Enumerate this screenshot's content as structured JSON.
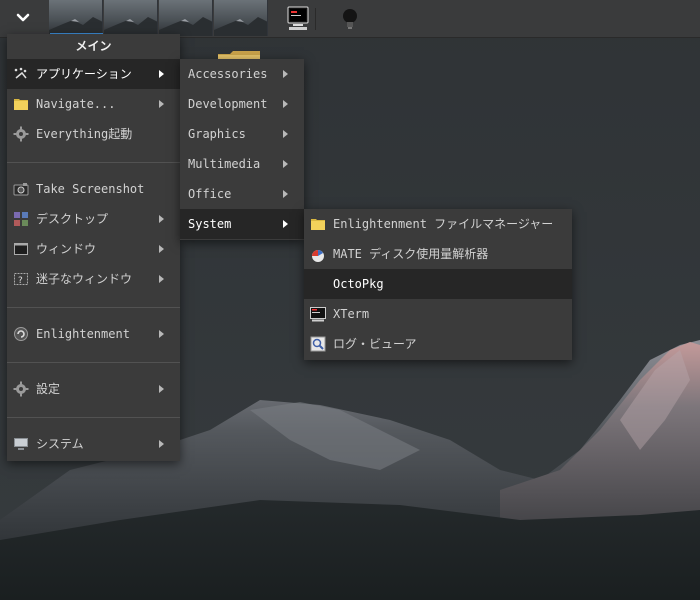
{
  "shelf": {
    "start_icon": "chevron-down-icon",
    "pager": {
      "desk_count": 4,
      "active_index": 0
    },
    "tray": [
      {
        "name": "xterm-icon"
      },
      {
        "name": "bulb-icon"
      }
    ]
  },
  "main_menu": {
    "title": "メイン",
    "items": [
      {
        "label": "アプリケーション",
        "icon": "applications-icon",
        "has_submenu": true,
        "active": true
      },
      {
        "label": "Navigate...",
        "icon": "folder-icon",
        "has_submenu": true
      },
      {
        "label": "Everything起動",
        "icon": "gear-icon",
        "has_submenu": false
      },
      {
        "label": "Take Screenshot",
        "icon": "camera-icon",
        "has_submenu": false
      },
      {
        "label": "デスクトップ",
        "icon": "desktop-grid-icon",
        "has_submenu": true
      },
      {
        "label": "ウィンドウ",
        "icon": "window-icon",
        "has_submenu": true
      },
      {
        "label": "迷子なウィンドウ",
        "icon": "lost-window-icon",
        "has_submenu": true
      },
      {
        "label": "Enlightenment",
        "icon": "enlightenment-icon",
        "has_submenu": true
      },
      {
        "label": "設定",
        "icon": "settings-gear-icon",
        "has_submenu": true
      },
      {
        "label": "システム",
        "icon": "computer-icon",
        "has_submenu": true
      }
    ]
  },
  "applications_menu": {
    "items": [
      {
        "label": "Accessories",
        "has_submenu": true
      },
      {
        "label": "Development",
        "has_submenu": true
      },
      {
        "label": "Graphics",
        "has_submenu": true
      },
      {
        "label": "Multimedia",
        "has_submenu": true
      },
      {
        "label": "Office",
        "has_submenu": true
      },
      {
        "label": "System",
        "has_submenu": true,
        "active": true
      }
    ]
  },
  "system_menu": {
    "items": [
      {
        "label": "Enlightenment ファイルマネージャー",
        "icon": "folder-icon"
      },
      {
        "label": "MATE ディスク使用量解析器",
        "icon": "disk-usage-icon"
      },
      {
        "label": "OctoPkg",
        "icon": "",
        "active": true
      },
      {
        "label": "XTerm",
        "icon": "terminal-icon"
      },
      {
        "label": "ログ・ビューア",
        "icon": "log-viewer-icon"
      }
    ]
  },
  "colors": {
    "menu_bg": "#3b3b3b",
    "active_bg": "#262626",
    "pager_accent": "#3d8fd8",
    "folder": "#f2d15b"
  }
}
